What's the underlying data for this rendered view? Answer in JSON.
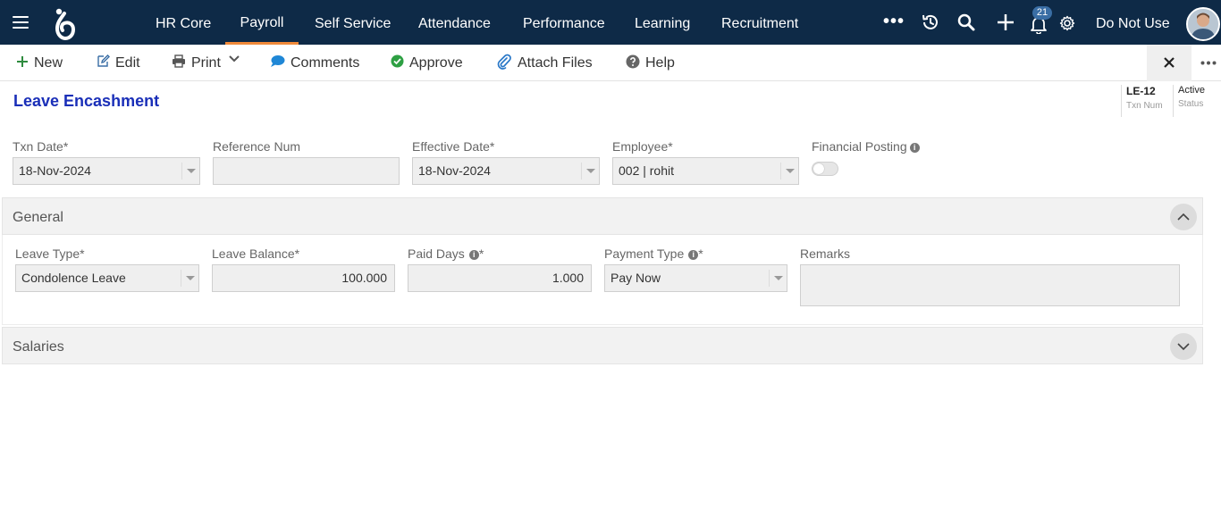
{
  "nav": {
    "tabs": [
      "HR Core",
      "Payroll",
      "Self Service",
      "Attendance",
      "Performance",
      "Learning",
      "Recruitment"
    ],
    "active_tab": "Payroll",
    "more": "•••",
    "notifications_count": "21",
    "user_name": "Do Not Use",
    "icons": [
      "menu-icon",
      "logo",
      "history-icon",
      "search-icon",
      "plus-icon",
      "bell-icon",
      "gear-icon",
      "avatar"
    ]
  },
  "toolbar": {
    "new": "New",
    "edit": "Edit",
    "print": "Print",
    "comments": "Comments",
    "approve": "Approve",
    "attach": "Attach Files",
    "help": "Help"
  },
  "colors": {
    "nav_bg": "#0e2a47",
    "title": "#1a2fb8",
    "approve": "#2ea043",
    "accent_tab": "#f08a3a"
  },
  "page": {
    "title": "Leave Encashment",
    "txn_num": "LE-12",
    "txn_num_label": "Txn Num",
    "status": "Active",
    "status_label": "Status"
  },
  "form": {
    "txn_date": {
      "label": "Txn Date",
      "value": "18-Nov-2024"
    },
    "reference_num": {
      "label": "Reference Num",
      "value": ""
    },
    "effective_date": {
      "label": "Effective Date",
      "value": "18-Nov-2024"
    },
    "employee": {
      "label": "Employee",
      "value": "002 | rohit"
    },
    "financial_posting": {
      "label": "Financial Posting",
      "enabled": false
    }
  },
  "sections": {
    "general": {
      "title": "General",
      "leave_type": {
        "label": "Leave Type",
        "value": "Condolence Leave"
      },
      "leave_balance": {
        "label": "Leave Balance",
        "value": "100.000"
      },
      "paid_days": {
        "label": "Paid Days",
        "value": "1.000"
      },
      "payment_type": {
        "label": "Payment Type",
        "value": "Pay Now"
      },
      "remarks": {
        "label": "Remarks",
        "value": ""
      }
    },
    "salaries": {
      "title": "Salaries"
    }
  }
}
